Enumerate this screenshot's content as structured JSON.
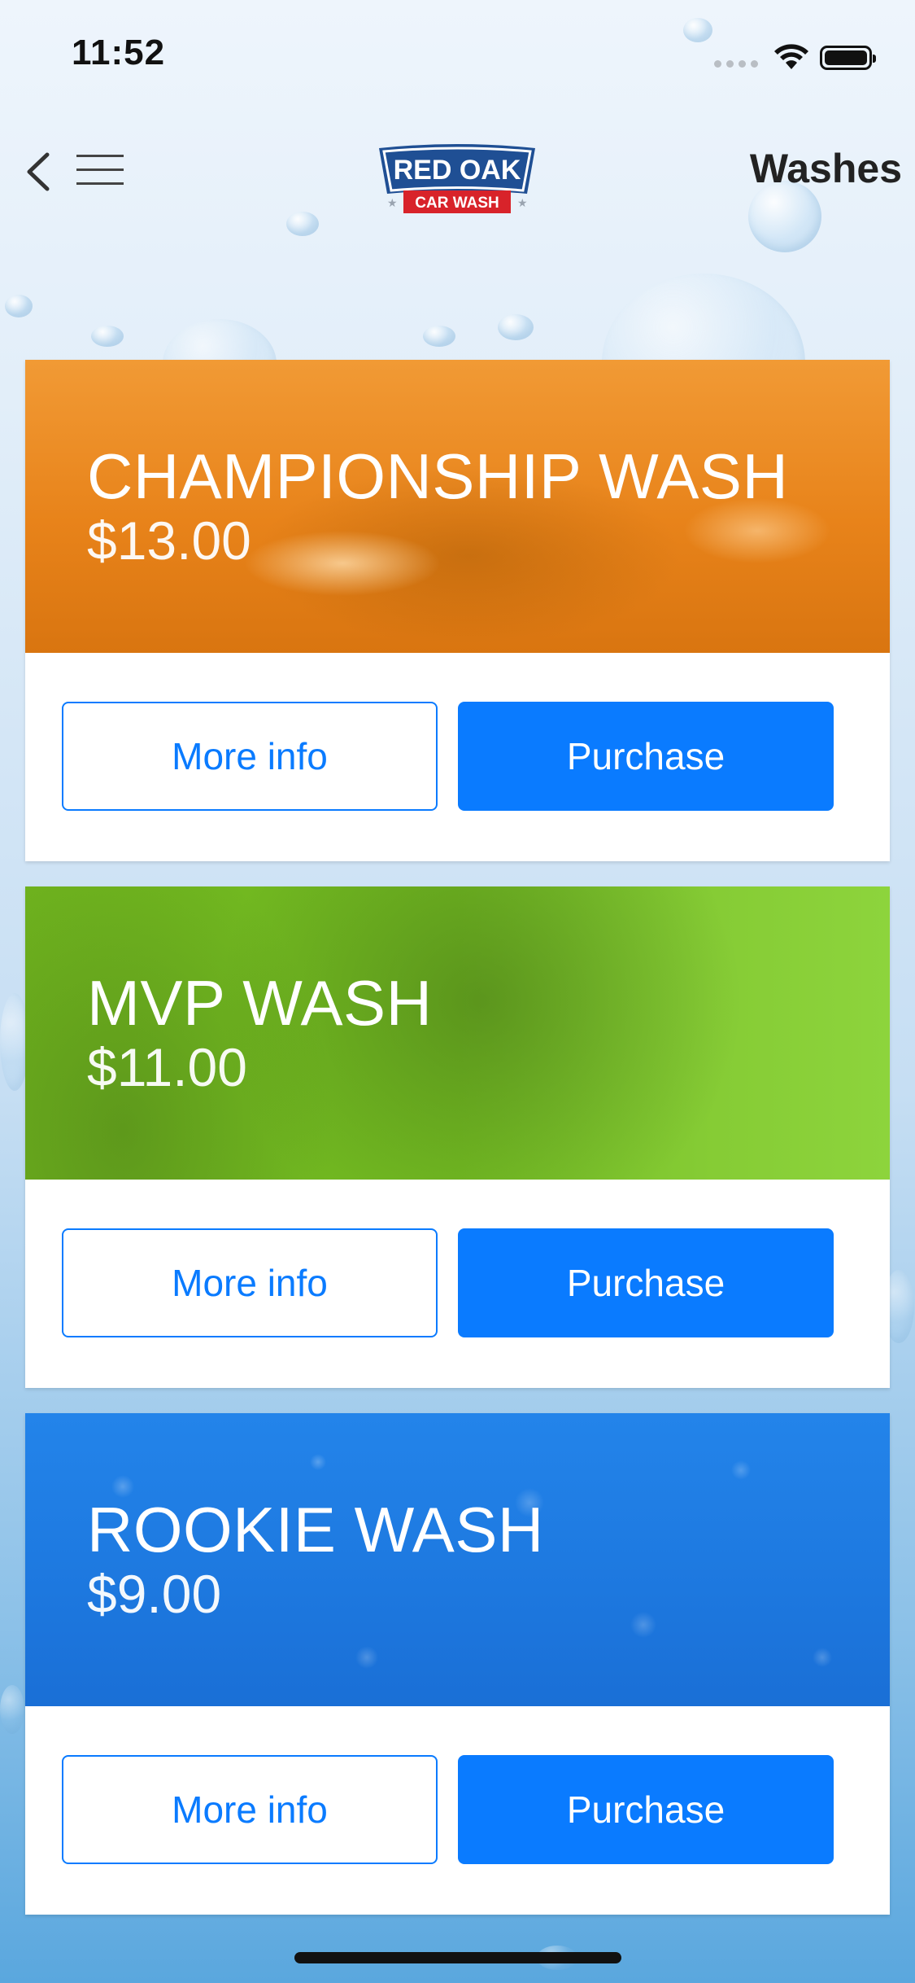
{
  "status_bar": {
    "time": "11:52"
  },
  "nav": {
    "title": "Washes",
    "logo_top": "RED OAK",
    "logo_bottom": "CAR WASH"
  },
  "washes": [
    {
      "name": "CHAMPIONSHIP WASH",
      "price": "$13.00",
      "color": "#ee8a1d",
      "more_info": "More info",
      "purchase": "Purchase"
    },
    {
      "name": "MVP WASH",
      "price": "$11.00",
      "color": "#7cc425",
      "more_info": "More info",
      "purchase": "Purchase"
    },
    {
      "name": "ROOKIE WASH",
      "price": "$9.00",
      "color": "#1f7fe3",
      "more_info": "More info",
      "purchase": "Purchase"
    }
  ],
  "colors": {
    "accent": "#0a7bff"
  }
}
